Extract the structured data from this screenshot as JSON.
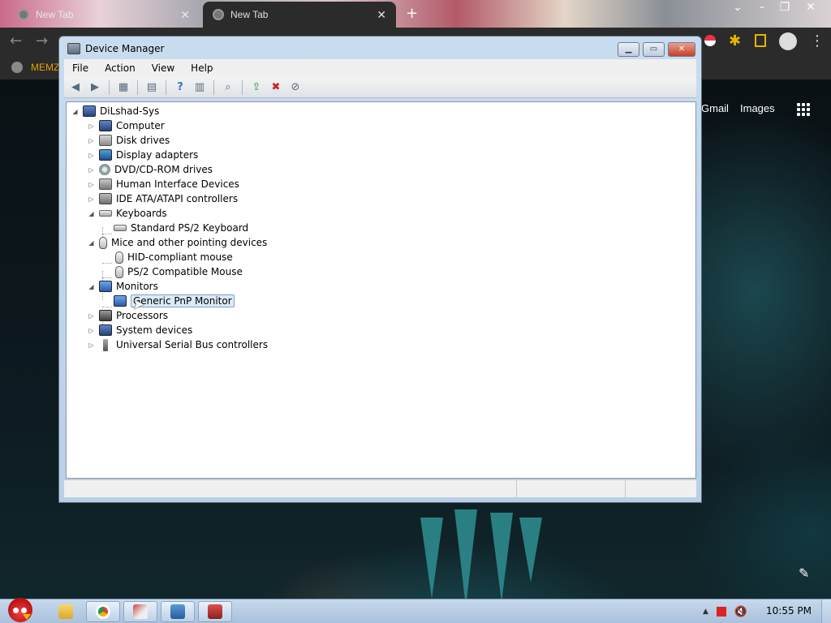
{
  "browser": {
    "tabs": [
      {
        "label": "New Tab",
        "close": "✕"
      },
      {
        "label": "New Tab",
        "close": "✕"
      }
    ],
    "new_tab": "+",
    "bookmark": "MEMZ",
    "gmail": "Gmail",
    "images": "Images"
  },
  "window": {
    "title": "Device Manager",
    "menu": [
      "File",
      "Action",
      "View",
      "Help"
    ]
  },
  "tree": {
    "root": "DiLshad-Sys",
    "categories": [
      {
        "label": "Computer",
        "expanded": false,
        "icon": "computer-icon"
      },
      {
        "label": "Disk drives",
        "expanded": false,
        "icon": "disk-drive-icon"
      },
      {
        "label": "Display adapters",
        "expanded": false,
        "icon": "display-adapter-icon"
      },
      {
        "label": "DVD/CD-ROM drives",
        "expanded": false,
        "icon": "dvd-drive-icon"
      },
      {
        "label": "Human Interface Devices",
        "expanded": false,
        "icon": "hid-icon"
      },
      {
        "label": "IDE ATA/ATAPI controllers",
        "expanded": false,
        "icon": "ide-controller-icon"
      },
      {
        "label": "Keyboards",
        "expanded": true,
        "icon": "keyboard-icon",
        "children": [
          "Standard PS/2 Keyboard"
        ]
      },
      {
        "label": "Mice and other pointing devices",
        "expanded": true,
        "icon": "mouse-icon",
        "children": [
          "HID-compliant mouse",
          "PS/2 Compatible Mouse"
        ]
      },
      {
        "label": "Monitors",
        "expanded": true,
        "icon": "monitor-icon",
        "children": [
          "Generic PnP Monitor"
        ],
        "selected_child": "Generic PnP Monitor"
      },
      {
        "label": "Processors",
        "expanded": false,
        "icon": "processor-icon"
      },
      {
        "label": "System devices",
        "expanded": false,
        "icon": "system-devices-icon"
      },
      {
        "label": "Universal Serial Bus controllers",
        "expanded": false,
        "icon": "usb-icon"
      }
    ]
  },
  "taskbar": {
    "clock": "10:55 PM"
  }
}
